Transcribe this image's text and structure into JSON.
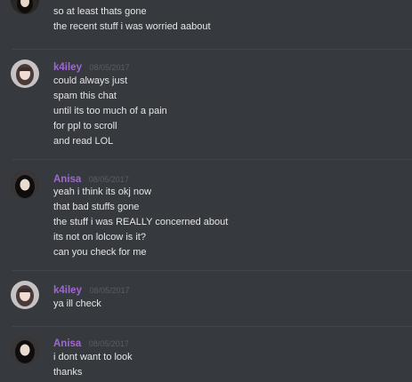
{
  "messages": [
    {
      "username": "",
      "timestamp": "",
      "lines": [
        "so at least thats gone",
        "the recent stuff i was worried aabout"
      ]
    },
    {
      "username": "k4iley",
      "timestamp": "08/05/2017",
      "lines": [
        "could always just",
        "spam this chat",
        "until its too much of a pain",
        "for ppl to scroll",
        "and read LOL"
      ]
    },
    {
      "username": "Anisa",
      "timestamp": "08/05/2017",
      "lines": [
        "yeah i think its okj now",
        "that bad stuffs gone",
        "the stuff i was REALLY concerned about",
        "its not on lolcow is it?",
        "can you check for me"
      ]
    },
    {
      "username": "k4iley",
      "timestamp": "08/05/2017",
      "lines": [
        "ya ill check"
      ]
    },
    {
      "username": "Anisa",
      "timestamp": "08/05/2017",
      "lines": [
        "i dont want to look",
        "thanks"
      ]
    }
  ],
  "colors": {
    "background": "#36393e",
    "username": "#a166d6",
    "timestamp": "#5a5d62",
    "text": "#e6e6e8"
  }
}
